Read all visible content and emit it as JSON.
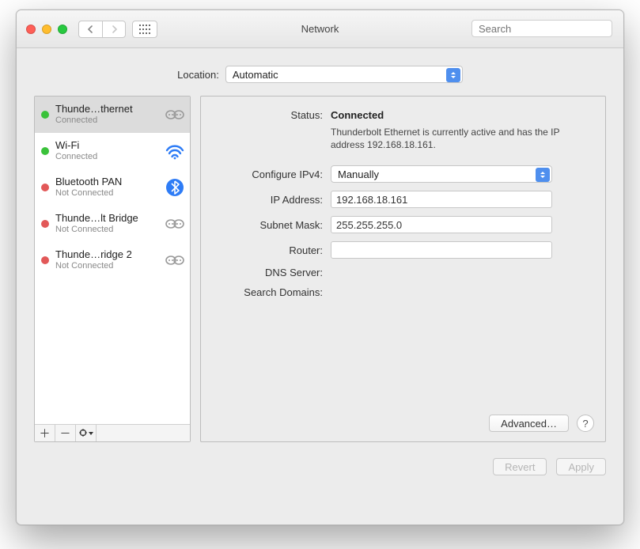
{
  "window": {
    "title": "Network"
  },
  "toolbar": {
    "search_placeholder": "Search"
  },
  "location": {
    "label": "Location:",
    "value": "Automatic"
  },
  "services": [
    {
      "name": "Thunde…thernet",
      "status": "Connected",
      "dot": "green",
      "icon": "chain"
    },
    {
      "name": "Wi-Fi",
      "status": "Connected",
      "dot": "green",
      "icon": "wifi"
    },
    {
      "name": "Bluetooth PAN",
      "status": "Not Connected",
      "dot": "red",
      "icon": "bt"
    },
    {
      "name": "Thunde…lt Bridge",
      "status": "Not Connected",
      "dot": "red",
      "icon": "chain"
    },
    {
      "name": "Thunde…ridge 2",
      "status": "Not Connected",
      "dot": "red",
      "icon": "chain"
    }
  ],
  "detail": {
    "status_label": "Status:",
    "status_value": "Connected",
    "status_desc": "Thunderbolt Ethernet is currently active and has the IP address 192.168.18.161.",
    "cfg_label": "Configure IPv4:",
    "cfg_value": "Manually",
    "ip_label": "IP Address:",
    "ip_value": "192.168.18.161",
    "mask_label": "Subnet Mask:",
    "mask_value": "255.255.255.0",
    "router_label": "Router:",
    "router_value": "",
    "dns_label": "DNS Server:",
    "search_label": "Search Domains:",
    "advanced": "Advanced…"
  },
  "buttons": {
    "revert": "Revert",
    "apply": "Apply"
  }
}
